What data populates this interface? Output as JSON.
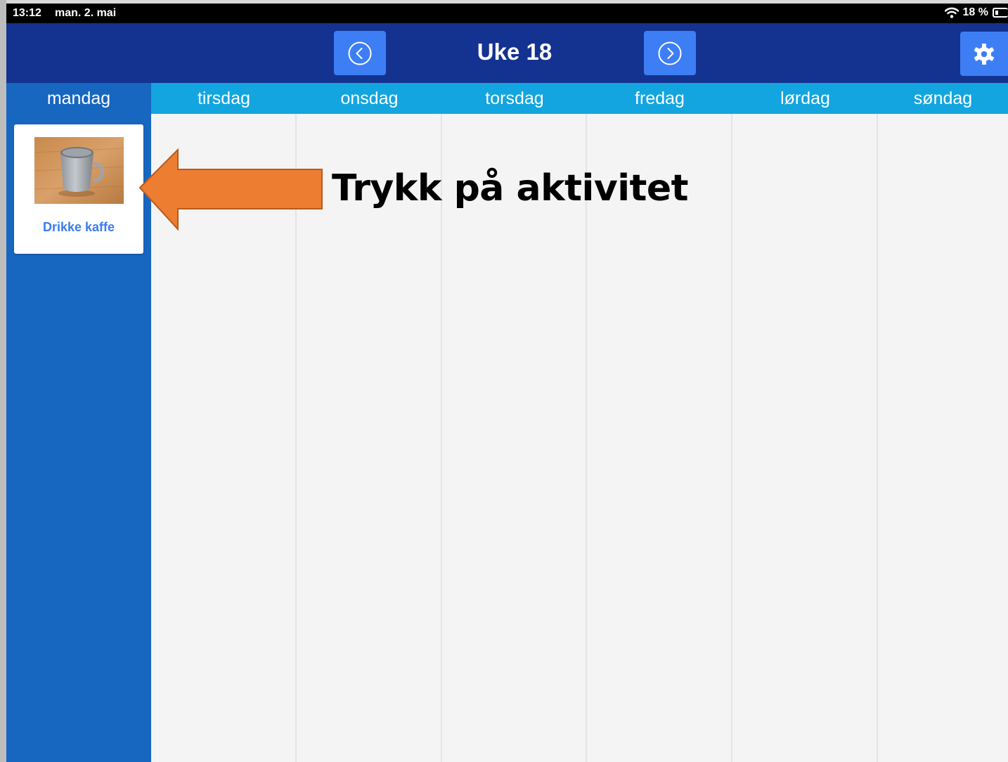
{
  "status_bar": {
    "time": "13:12",
    "date": "man. 2. mai",
    "battery": "18 %"
  },
  "header": {
    "week_title": "Uke 18"
  },
  "days": [
    {
      "label": "mandag",
      "active": true
    },
    {
      "label": "tirsdag",
      "active": false
    },
    {
      "label": "onsdag",
      "active": false
    },
    {
      "label": "torsdag",
      "active": false
    },
    {
      "label": "fredag",
      "active": false
    },
    {
      "label": "lørdag",
      "active": false
    },
    {
      "label": "søndag",
      "active": false
    }
  ],
  "activity": {
    "label": "Drikke kaffe",
    "icon": "coffee-cup-photo"
  },
  "annotation": {
    "text": "Trykk på aktivitet",
    "arrow_color": "#ed7d31"
  },
  "colors": {
    "header": "#14328f",
    "days_bar": "#12a5e0",
    "active_day": "#1766c0",
    "button": "#3d7ef5",
    "activity_label": "#3a7bf0"
  }
}
